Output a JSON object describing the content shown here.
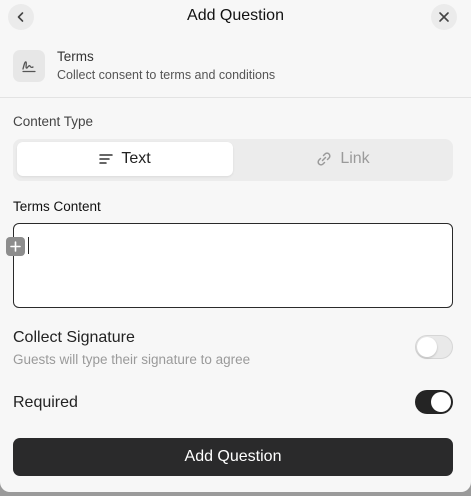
{
  "header": {
    "title": "Add Question"
  },
  "question_type": {
    "title": "Terms",
    "description": "Collect consent to terms and conditions"
  },
  "content_type": {
    "label": "Content Type",
    "options": [
      {
        "label": "Text",
        "icon": "text-lines-icon",
        "selected": true
      },
      {
        "label": "Link",
        "icon": "link-icon",
        "selected": false
      }
    ]
  },
  "terms_content": {
    "label": "Terms Content",
    "value": ""
  },
  "collect_signature": {
    "label": "Collect Signature",
    "description": "Guests will type their signature to agree",
    "enabled": false
  },
  "required": {
    "label": "Required",
    "enabled": true
  },
  "submit_label": "Add Question",
  "colors": {
    "primary": "#2a2a2b",
    "background": "#f7f7f7",
    "muted_text": "#9a9a9a"
  }
}
